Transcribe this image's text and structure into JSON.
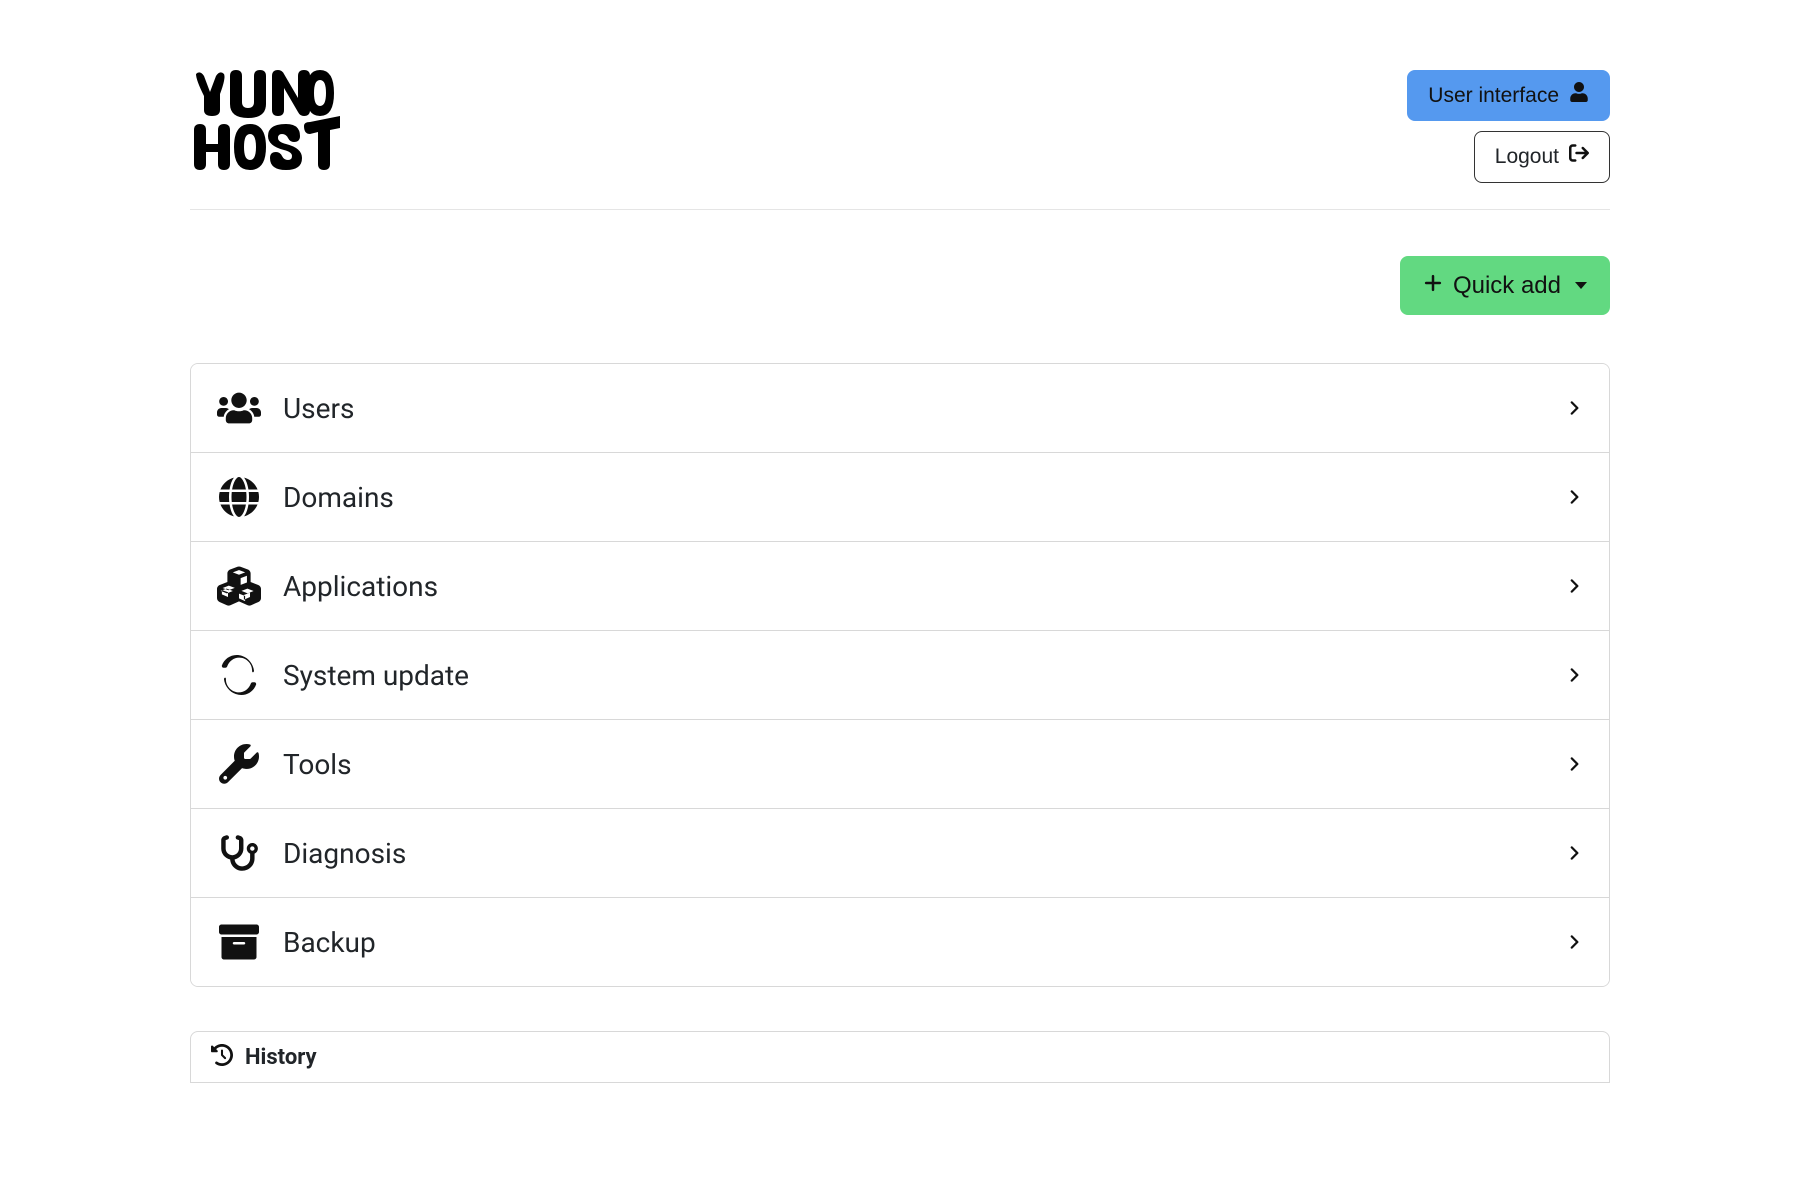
{
  "header": {
    "logo_text": "YUNO HOST",
    "user_interface_label": "User interface",
    "logout_label": "Logout"
  },
  "toolbar": {
    "quick_add_label": "Quick add"
  },
  "menu": {
    "items": [
      {
        "icon": "users-icon",
        "label": "Users"
      },
      {
        "icon": "globe-icon",
        "label": "Domains"
      },
      {
        "icon": "cubes-icon",
        "label": "Applications"
      },
      {
        "icon": "refresh-icon",
        "label": "System update"
      },
      {
        "icon": "wrench-icon",
        "label": "Tools"
      },
      {
        "icon": "stethoscope-icon",
        "label": "Diagnosis"
      },
      {
        "icon": "archive-icon",
        "label": "Backup"
      }
    ]
  },
  "footer": {
    "history_label": "History"
  },
  "colors": {
    "primary": "#5599ef",
    "success": "#62d981",
    "text": "#212529",
    "border": "#d8d8d8"
  }
}
